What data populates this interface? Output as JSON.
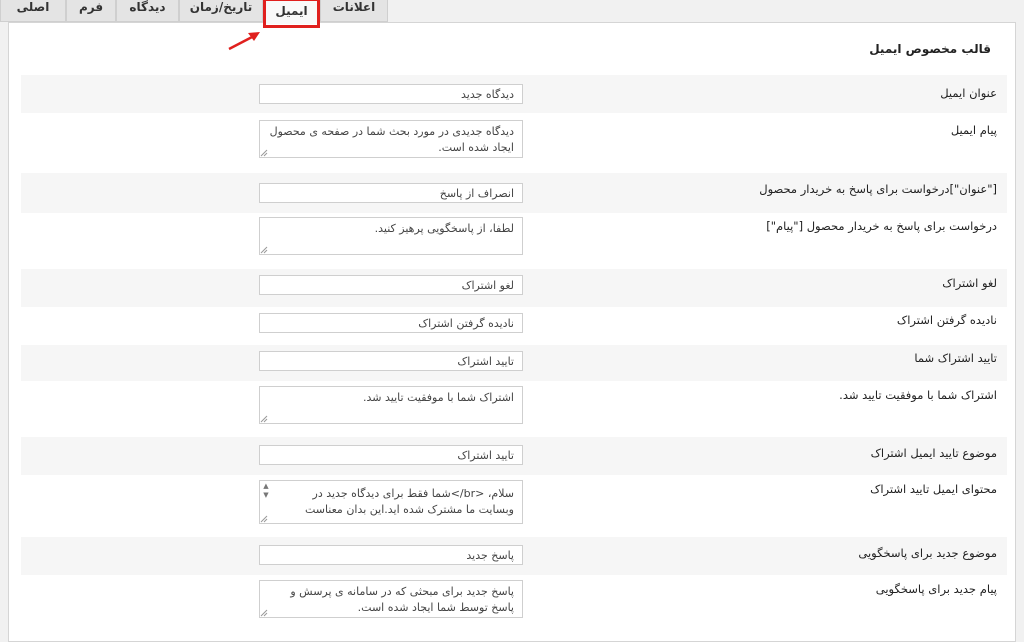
{
  "tabs": {
    "general": "اصلی",
    "form": "فرم",
    "comment": "دیدگاه",
    "datetime": "تاریخ/زمان",
    "email": "ایمیل",
    "notifications": "اعلانات"
  },
  "accent": {
    "highlight": "#e0201e"
  },
  "section_title": "قالب مخصوص ایمیل",
  "fields": [
    {
      "label": "عنوان ایمیل",
      "value": "دیدگاه جدید"
    },
    {
      "label": "پیام ایمیل",
      "value": "دیدگاه جدیدی در مورد بحث شما در صفحه ی محصول ایجاد شده است."
    },
    {
      "label": "[\"عنوان\"]درخواست برای پاسخ به خریدار محصول",
      "value": "انصراف از پاسخ"
    },
    {
      "label": "درخواست برای پاسخ به خریدار محصول [\"پیام\"]",
      "value": "لطفا، از پاسخگویی پرهیز کنید."
    },
    {
      "label": "لغو اشتراک",
      "value": "لغو اشتراک"
    },
    {
      "label": "نادیده گرفتن اشتراک",
      "value": "نادیده گرفتن اشتراک"
    },
    {
      "label": "تایید اشتراک شما",
      "value": "تایید اشتراک"
    },
    {
      "label": "اشتراک شما با موفقیت تایید شد.",
      "value": "اشتراک شما با موفقیت تایید شد."
    },
    {
      "label": "موضوع تایید ایمیل اشتراک",
      "value": "تایید اشتراک"
    },
    {
      "label": "محتوای ایمیل تایید اشتراک",
      "value": "سلام، <br/>شما فقط برای دیدگاه جدید در وبسایت ما مشترک شده اید.این بدان معناست"
    },
    {
      "label": "موضوع جدید برای پاسخگویی",
      "value": "پاسخ جدید"
    },
    {
      "label": "پیام جدید برای پاسخگویی",
      "value": "پاسخ جدید برای مبحثی که در سامانه ی پرسش و پاسخ توسط شما ایجاد شده است."
    }
  ]
}
